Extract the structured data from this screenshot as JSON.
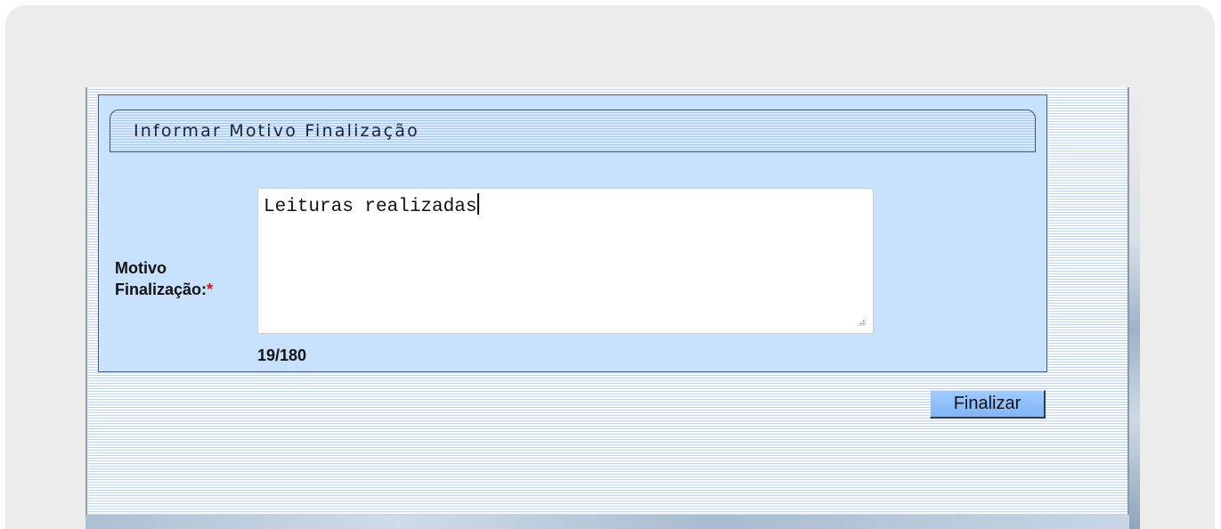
{
  "panel": {
    "title": "Informar Motivo Finalização"
  },
  "form": {
    "field_label_line1": "Motivo",
    "field_label_line2": "Finalização:",
    "required_marker": "*",
    "textarea_value": "Leituras realizadas",
    "char_counter": "19/180"
  },
  "actions": {
    "submit_label": "Finalizar"
  },
  "colors": {
    "panel_bg": "#c7e0fb",
    "button_bg": "#7fb4f6",
    "required": "#e01515"
  }
}
